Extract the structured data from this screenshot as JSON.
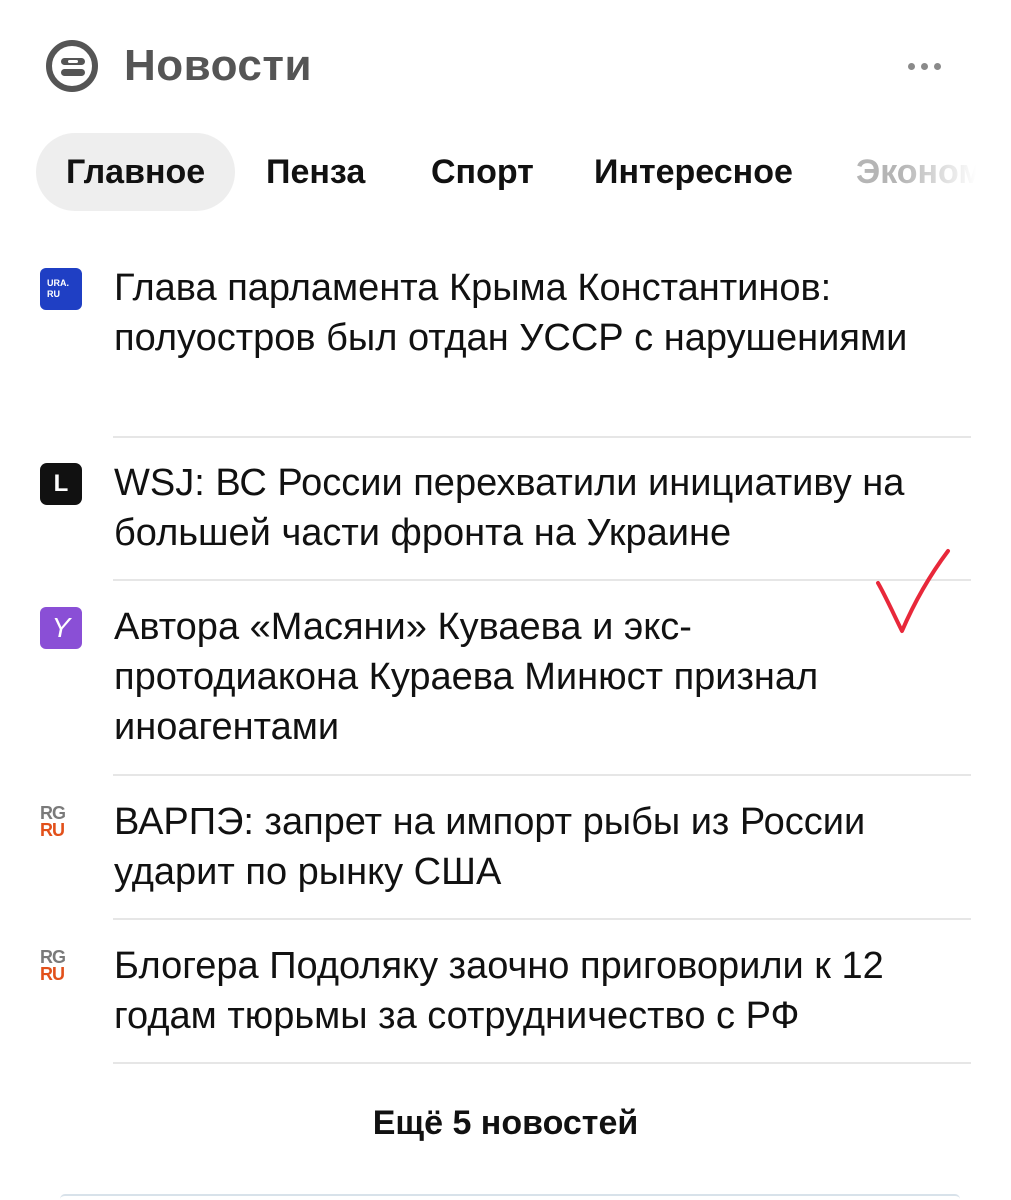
{
  "header": {
    "title": "Новости",
    "logo_icon": "news-logo-icon",
    "more_icon": "more-dots-icon"
  },
  "tabs": [
    {
      "label": "Главное",
      "active": true
    },
    {
      "label": "Пенза",
      "active": false
    },
    {
      "label": "Спорт",
      "active": false
    },
    {
      "label": "Интересное",
      "active": false
    },
    {
      "label": "Эконом",
      "active": false
    }
  ],
  "news": [
    {
      "source_icon": "ura-ru-icon",
      "source_icon_text": [
        "URA.",
        "RU"
      ],
      "headline": "Глава парламента Крыма Константинов: полуостров был отдан УССР с нарушениями"
    },
    {
      "source_icon": "l-source-icon",
      "source_icon_text": [
        "L"
      ],
      "headline": "WSJ: ВС России перехватили инициативу на большей части фронта на Украине"
    },
    {
      "source_icon": "y-source-icon",
      "source_icon_text": [
        "Y"
      ],
      "headline": "Автора «Масяни» Куваева и экс-протодиакона Кураева Минюст признал иноагентами"
    },
    {
      "source_icon": "rg-ru-icon",
      "source_icon_text": [
        "RG",
        "RU"
      ],
      "headline": "ВАРПЭ: запрет на импорт рыбы из России ударит по рынку США"
    },
    {
      "source_icon": "rg-ru-icon",
      "source_icon_text": [
        "RG",
        "RU"
      ],
      "headline": "Блогера Подоляку заочно приговорили к 12 годам тюрьмы за сотрудничество с РФ"
    }
  ],
  "more_news_label": "Ещё 5 новостей",
  "colors": {
    "active_tab_bg": "#eeeeee",
    "checkmark": "#e8283a",
    "ura_blue": "#1f3fc4",
    "y_purple": "#8a4fd6",
    "rg_orange": "#e2501a"
  }
}
